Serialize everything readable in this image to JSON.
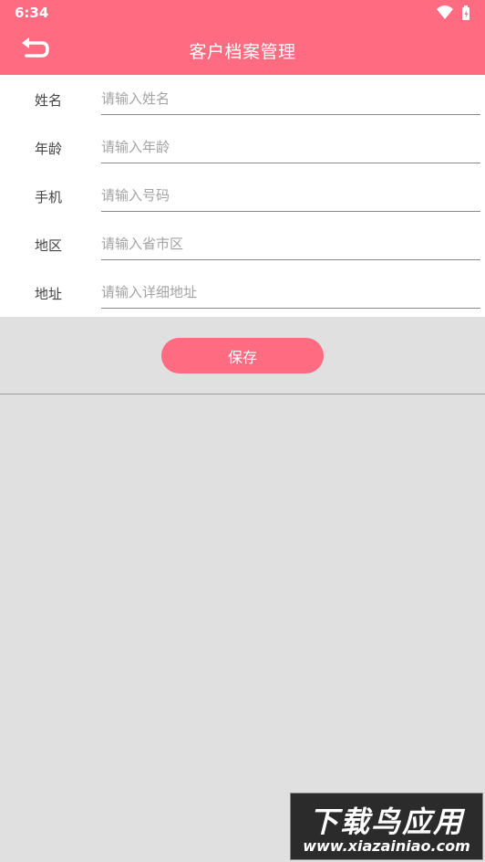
{
  "status_bar": {
    "time": "6:34",
    "icons": [
      "wifi-icon",
      "battery-icon"
    ]
  },
  "header": {
    "title": "客户档案管理",
    "back_icon": "back-arrow-icon"
  },
  "form": {
    "fields": [
      {
        "label": "姓名",
        "placeholder": "请输入姓名",
        "value": ""
      },
      {
        "label": "年龄",
        "placeholder": "请输入年龄",
        "value": ""
      },
      {
        "label": "手机",
        "placeholder": "请输入号码",
        "value": ""
      },
      {
        "label": "地区",
        "placeholder": "请输入省市区",
        "value": ""
      },
      {
        "label": "地址",
        "placeholder": "请输入详细地址",
        "value": ""
      }
    ]
  },
  "actions": {
    "save_label": "保存"
  },
  "watermark": {
    "title": "下载鸟应用",
    "site": "www.xiazainiao.com"
  },
  "colors": {
    "accent": "#ff6b80",
    "form_background": "#ffffff",
    "page_background": "#e0e0e0"
  }
}
